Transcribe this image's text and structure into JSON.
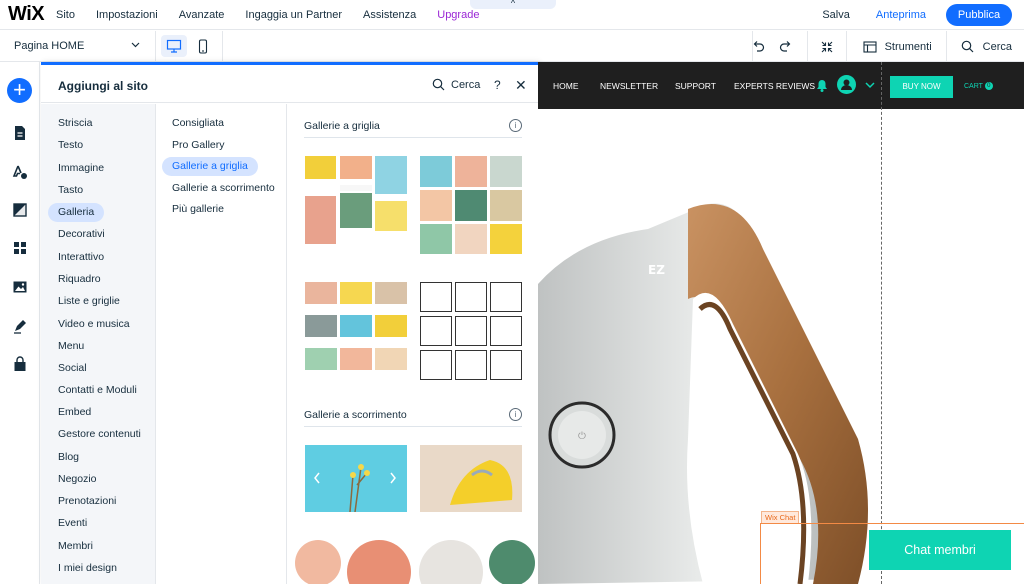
{
  "app": {
    "logo": "WiX",
    "menu": [
      "Sito",
      "Impostazioni",
      "Avanzate",
      "Ingaggia un Partner",
      "Assistenza",
      "Upgrade"
    ],
    "collapse_icon": "^",
    "save": "Salva",
    "preview": "Anteprima",
    "publish": "Pubblica"
  },
  "toolbar": {
    "page_label": "Pagina HOME",
    "tools": "Strumenti",
    "search": "Cerca"
  },
  "panel": {
    "title": "Aggiungi al sito",
    "search": "Cerca",
    "help": "?",
    "close": "✕",
    "categories": [
      "Striscia",
      "Testo",
      "Immagine",
      "Tasto",
      "Galleria",
      "Decorativi",
      "Interattivo",
      "Riquadro",
      "Liste e griglie",
      "Video e musica",
      "Menu",
      "Social",
      "Contatti e Moduli",
      "Embed",
      "Gestore contenuti",
      "Blog",
      "Negozio",
      "Prenotazioni",
      "Eventi",
      "Membri",
      "I miei design"
    ],
    "selected_category": 4,
    "subcategories": [
      "Consigliata",
      "Pro Gallery",
      "Gallerie a griglia",
      "Gallerie a scorrimento",
      "Più gallerie"
    ],
    "selected_subcategory": 2,
    "section_grid": "Gallerie a griglia",
    "section_slider": "Gallerie a scorrimento",
    "info": "i"
  },
  "site": {
    "nav": [
      "HOME",
      "NEWSLETTER",
      "SUPPORT",
      "EXPERTS REVIEWS"
    ],
    "buy_now": "BUY NOW",
    "cart": "CART",
    "cart_count": "0",
    "product_mark": "EZ",
    "chat_label": "Wix Chat",
    "chat_button": "Chat membri"
  },
  "colors": {
    "accent": "#116dff",
    "upgrade": "#9a27d5",
    "site_accent": "#0ed4b3",
    "chat_frame": "#f38a45"
  }
}
